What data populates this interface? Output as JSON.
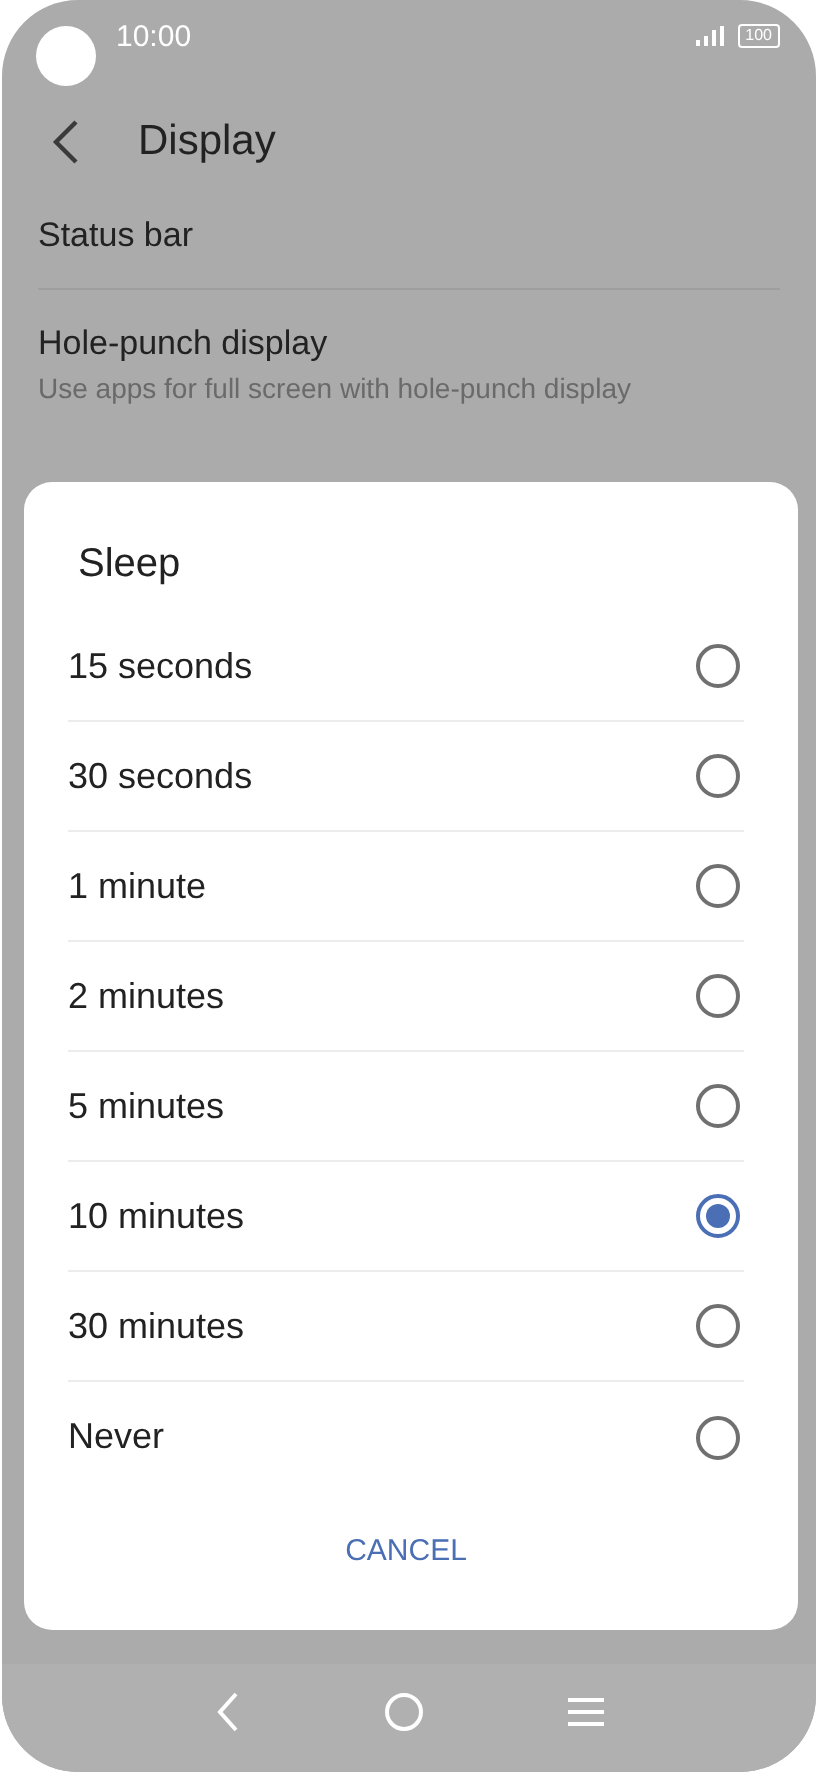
{
  "status_bar": {
    "time": "10:00",
    "battery": "100"
  },
  "header": {
    "title": "Display"
  },
  "settings": [
    {
      "title": "Status bar"
    },
    {
      "title": "Hole-punch display",
      "subtitle": "Use apps for full screen with hole-punch display"
    }
  ],
  "dialog": {
    "title": "Sleep",
    "options": [
      {
        "label": "15 seconds",
        "selected": false
      },
      {
        "label": "30 seconds",
        "selected": false
      },
      {
        "label": "1 minute",
        "selected": false
      },
      {
        "label": "2 minutes",
        "selected": false
      },
      {
        "label": "5 minutes",
        "selected": false
      },
      {
        "label": "10 minutes",
        "selected": true
      },
      {
        "label": "30 minutes",
        "selected": false
      },
      {
        "label": "Never",
        "selected": false
      }
    ],
    "cancel": "CANCEL"
  }
}
